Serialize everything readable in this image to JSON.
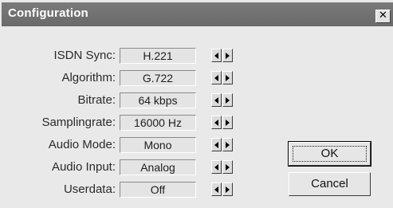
{
  "window": {
    "title": "Configuration",
    "close_glyph": "✕"
  },
  "settings": [
    {
      "label": "ISDN Sync:",
      "value": "H.221"
    },
    {
      "label": "Algorithm:",
      "value": "G.722"
    },
    {
      "label": "Bitrate:",
      "value": "64 kbps"
    },
    {
      "label": "Samplingrate:",
      "value": "16000 Hz"
    },
    {
      "label": "Audio Mode:",
      "value": "Mono"
    },
    {
      "label": "Audio Input:",
      "value": "Analog"
    },
    {
      "label": "Userdata:",
      "value": "Off"
    }
  ],
  "buttons": {
    "ok_label": "OK",
    "cancel_label": "Cancel"
  },
  "icons": {
    "decrement": "triangle-left-icon",
    "increment": "triangle-right-icon",
    "close": "close-icon"
  }
}
